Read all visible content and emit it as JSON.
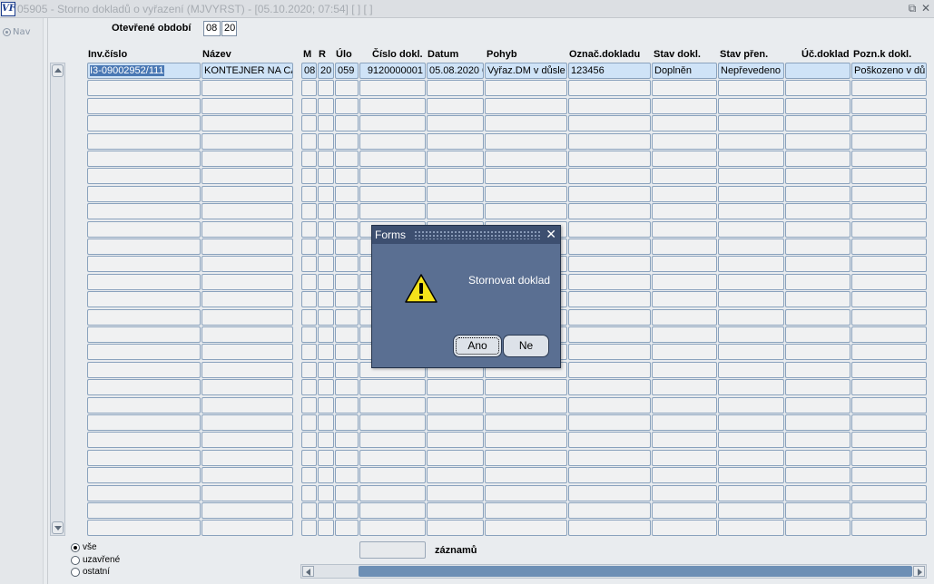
{
  "window": {
    "logo_text": "VF",
    "title": "05905 - Storno dokladů o vyřazení (MJVYRST) - [05.10.2020; 07:54]  [ ]  [ ]",
    "restore_glyph": "⧉",
    "close_glyph": "✕"
  },
  "nav": {
    "label": "Nav"
  },
  "period": {
    "label": "Otevřené období",
    "month": "08",
    "year": "20"
  },
  "columns": [
    "Inv.číslo",
    "Název",
    "M",
    "R",
    "Úlo",
    "Číslo dokl.",
    "Datum",
    "Pohyb",
    "Označ.dokladu",
    "Stav dokl.",
    "Stav přen.",
    "Úč.doklad",
    "Pozn.k dokl."
  ],
  "rows": [
    {
      "inv_cislo": "I3-09002952/111",
      "nazev": "KONTEJNER NA CA",
      "m": "08",
      "r": "20",
      "ulo": "059",
      "cislo_dokl": "9120000001",
      "datum": "05.08.2020 0",
      "pohyb": "Vyřaz.DM v důsle",
      "oznac_dokladu": "123456",
      "stav_dokl": "Doplněn",
      "stav_pren": "Nepřevedeno",
      "uc_doklad": "",
      "pozn": "Poškozeno v dů"
    }
  ],
  "filter": {
    "options": [
      "vše",
      "uzavřené",
      "ostatní"
    ],
    "selected": "vše"
  },
  "records": {
    "count": "",
    "label": "záznamů"
  },
  "dialog": {
    "title": "Forms",
    "message": "Stornovat doklad",
    "yes_label": "Ano",
    "no_label": "Ne",
    "close_glyph": "✕",
    "icon": "warning-icon"
  },
  "colors": {
    "dialog_bg": "#5a6f92",
    "selected_row": "#cfe3f7",
    "cell_border": "#8aa2bd"
  }
}
